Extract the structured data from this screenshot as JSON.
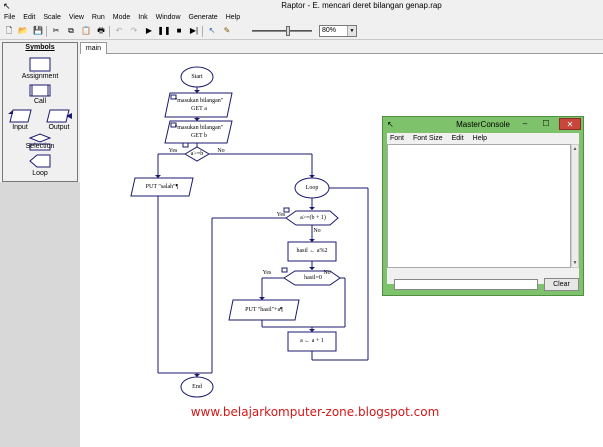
{
  "window": {
    "title": "Raptor - E. mencari deret bilangan genap.rap"
  },
  "menu": [
    "File",
    "Edit",
    "Scale",
    "View",
    "Run",
    "Mode",
    "Ink",
    "Window",
    "Generate",
    "Help"
  ],
  "toolbar": {
    "zoom_value": "80%"
  },
  "symbols": {
    "header": "Symbols",
    "items": [
      "Assignment",
      "Call",
      "Input",
      "Output",
      "Selection",
      "Loop"
    ]
  },
  "tab": {
    "label": "main"
  },
  "flowchart": {
    "start": "Start",
    "input_a_prompt": "\"masukan bilangan\"",
    "input_a_get": "GET a",
    "input_b_prompt": "\"masukan bilangan\"",
    "input_b_get": "GET b",
    "cond1": "a>=b",
    "yes": "Yes",
    "no": "No",
    "output_salah": "PUT \"salah\"¶",
    "loop": "Loop",
    "loop_cond": "a>=(b + 1)",
    "assign_hasil": "hasil ← a%2",
    "cond2": "hasil=0",
    "output_hasil": "PUT \"hasil\"+a¶",
    "assign_inc": "a ← a + 1",
    "end": "End"
  },
  "console": {
    "title": "MasterConsole",
    "menu": [
      "Font",
      "Font Size",
      "Edit",
      "Help"
    ],
    "clear_label": "Clear"
  },
  "watermark": "www.belajarkomputer-zone.blogspot.com"
}
